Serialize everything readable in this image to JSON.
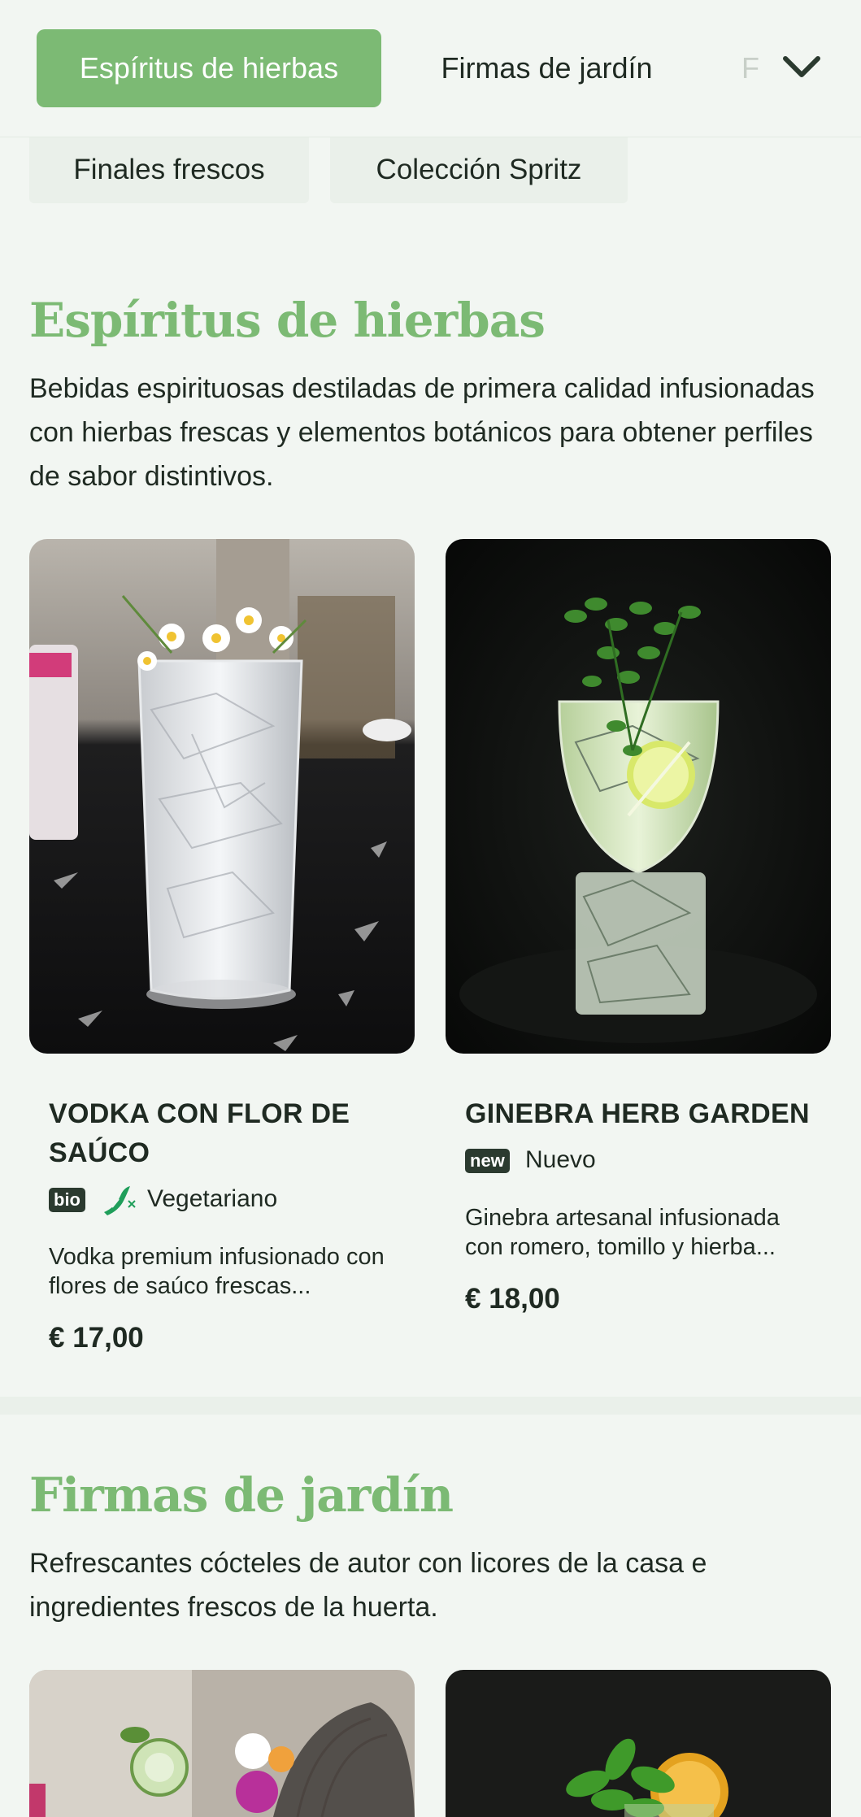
{
  "nav": {
    "tabs": [
      "Espíritus de hierbas",
      "Firmas de jardín",
      "F"
    ],
    "subtabs": [
      "Finales frescos",
      "Colección Spritz"
    ]
  },
  "sections": [
    {
      "title": "Espíritus de hierbas",
      "description": "Bebidas espirituosas destiladas de primera calidad infusionadas con hierbas frescas y elementos botánicos para obtener perfiles de sabor distintivos.",
      "products": [
        {
          "name": "VODKA CON FLOR DE SAÚCO",
          "badge": "bio",
          "tag": "Vegetariano",
          "description": "Vodka premium infusionado con flores de saúco frescas...",
          "price": "€ 17,00"
        },
        {
          "name": "GINEBRA HERB GARDEN",
          "badge": "new",
          "tag": "Nuevo",
          "description": "Ginebra artesanal infusionada con romero, tomillo y hierba...",
          "price": "€ 18,00"
        }
      ]
    },
    {
      "title": "Firmas de jardín",
      "description": "Refrescantes cócteles de autor con licores de la casa e ingredientes frescos de la huerta."
    }
  ],
  "colors": {
    "accent": "#7cba74",
    "background": "#f2f6f2",
    "text": "#1f2a22",
    "vegetarian_icon": "#1f9e5a"
  },
  "icons": [
    "chevron-down-icon",
    "vegetarian-icon"
  ]
}
